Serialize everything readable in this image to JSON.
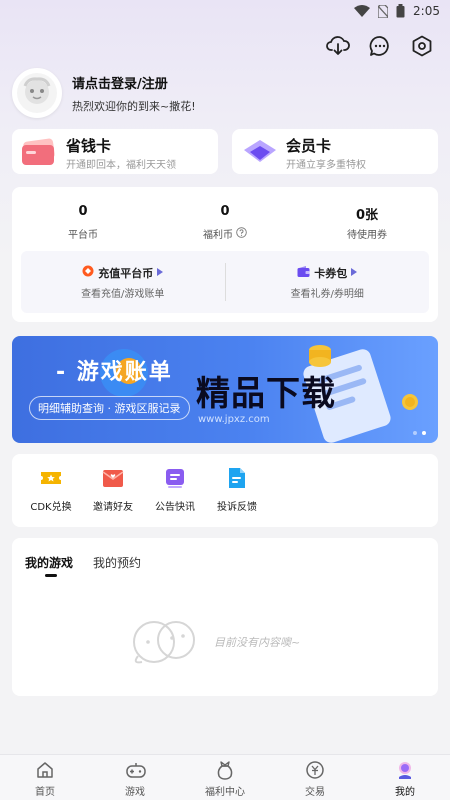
{
  "status_bar": {
    "time": "2:05"
  },
  "header": {
    "icons": [
      "download-cloud-icon",
      "message-icon",
      "settings-icon"
    ]
  },
  "profile": {
    "name": "请点击登录/注册",
    "welcome": "热烈欢迎你的到来~撒花!"
  },
  "cards": [
    {
      "title": "省钱卡",
      "subtitle": "开通即回本，福利天天领"
    },
    {
      "title": "会员卡",
      "subtitle": "开通立享多重特权"
    }
  ],
  "stats": [
    {
      "value": "0",
      "label": "平台币"
    },
    {
      "value": "0",
      "label": "福利币"
    },
    {
      "value": "0张",
      "label": "待使用券"
    }
  ],
  "wallet": {
    "recharge": {
      "title": "充值平台币",
      "subtitle": "查看充值/游戏账单"
    },
    "coupons": {
      "title": "卡券包",
      "subtitle": "查看礼券/券明细"
    }
  },
  "banner": {
    "title": "- 游戏账单",
    "subtitle": "明细辅助查询 · 游戏区服记录",
    "watermark": "精品下载",
    "watermark_url": "www.jpxz.com",
    "slides": 2,
    "active_slide": 2
  },
  "quick_actions": [
    {
      "label": "CDK兑换",
      "icon": "cdk-ticket-icon",
      "color": "#f5b400"
    },
    {
      "label": "邀请好友",
      "icon": "invite-envelope-icon",
      "color": "#f05a4a"
    },
    {
      "label": "公告快讯",
      "icon": "announcement-icon",
      "color": "#8a5cf0"
    },
    {
      "label": "投诉反馈",
      "icon": "feedback-doc-icon",
      "color": "#1ea4f0"
    }
  ],
  "games": {
    "tabs": [
      "我的游戏",
      "我的预约"
    ],
    "active_tab": 0,
    "empty_text": "目前没有内容噢~"
  },
  "bottom_nav": [
    {
      "label": "首页",
      "icon": "home-icon"
    },
    {
      "label": "游戏",
      "icon": "gamepad-icon"
    },
    {
      "label": "福利中心",
      "icon": "gift-bag-icon"
    },
    {
      "label": "交易",
      "icon": "trade-coin-icon"
    },
    {
      "label": "我的",
      "icon": "profile-avatar-icon",
      "active": true
    }
  ],
  "colors": {
    "accent_purple": "#6b4cf0",
    "banner_blue": "#4b82f0",
    "background": "#f3f3f5"
  }
}
